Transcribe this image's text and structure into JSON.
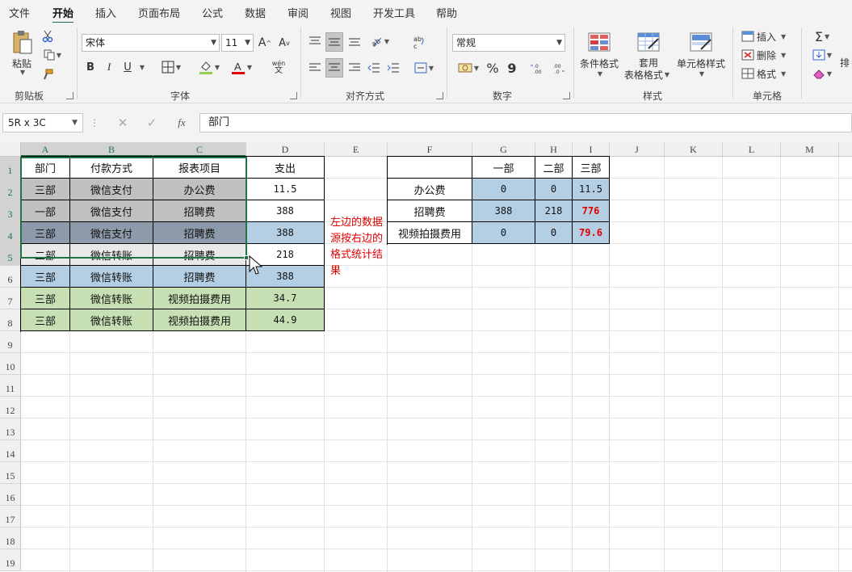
{
  "ribbon_tabs": [
    "文件",
    "开始",
    "插入",
    "页面布局",
    "公式",
    "数据",
    "审阅",
    "视图",
    "开发工具",
    "帮助"
  ],
  "active_tab": "开始",
  "clipboard": {
    "paste": "粘贴",
    "label": "剪贴板"
  },
  "font": {
    "name": "宋体",
    "size": "11",
    "bold": "B",
    "italic": "I",
    "underline": "U",
    "phonetic": "wén",
    "label": "字体"
  },
  "alignment": {
    "label": "对齐方式"
  },
  "number": {
    "format": "常规",
    "percent": "%",
    "comma": "9",
    "label": "数字"
  },
  "styles": {
    "conditional": "条件格式",
    "table_1": "套用",
    "table_2": "表格格式",
    "cell_styles": "单元格样式",
    "label": "样式"
  },
  "cells": {
    "insert": "插入",
    "delete": "删除",
    "format": "格式",
    "label": "单元格"
  },
  "editing": {
    "sort_partial": "排"
  },
  "formula_bar": {
    "name_box": "5R x 3C",
    "fx": "fx",
    "content": "部门"
  },
  "columns": [
    "A",
    "B",
    "C",
    "D",
    "E",
    "F",
    "G",
    "H",
    "I",
    "J",
    "K",
    "L",
    "M"
  ],
  "rows": [
    "1",
    "2",
    "3",
    "4",
    "5",
    "6",
    "7",
    "8",
    "9",
    "10",
    "11",
    "12",
    "13",
    "14",
    "15",
    "16",
    "17",
    "18",
    "19"
  ],
  "source_table": {
    "headers": [
      "部门",
      "付款方式",
      "报表项目",
      "支出"
    ],
    "rows": [
      [
        "三部",
        "微信支付",
        "办公费",
        "11.5"
      ],
      [
        "一部",
        "微信支付",
        "招聘费",
        "388"
      ],
      [
        "三部",
        "微信支付",
        "招聘费",
        "388"
      ],
      [
        "二部",
        "微信转账",
        "招聘费",
        "218"
      ],
      [
        "三部",
        "微信转账",
        "招聘费",
        "388"
      ],
      [
        "三部",
        "微信转账",
        "视频拍摄费用",
        "34.7"
      ],
      [
        "三部",
        "微信转账",
        "视频拍摄费用",
        "44.9"
      ]
    ]
  },
  "note": "左边的数据源按右边的格式统计结果",
  "summary_table": {
    "headers": [
      "",
      "一部",
      "二部",
      "三部"
    ],
    "rows": [
      [
        "办公费",
        "0",
        "0",
        "11.5"
      ],
      [
        "招聘费",
        "388",
        "218",
        "776"
      ],
      [
        "视频拍摄费用",
        "0",
        "0",
        "79.6"
      ]
    ]
  },
  "colors": {
    "accent": "#217346",
    "highlight_red": "#e00000",
    "fill_blue": "#b4cfe4",
    "fill_green": "#c6e0b4",
    "fill_grey": "#c0c0c0"
  }
}
